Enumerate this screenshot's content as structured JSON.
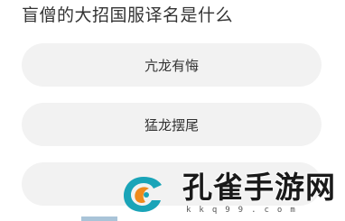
{
  "question": "盲僧的大招国服译名是什么",
  "options": [
    {
      "label": "亢龙有悔"
    },
    {
      "label": "猛龙摆尾"
    },
    {
      "label": ""
    }
  ],
  "watermark": {
    "title": "孔雀手游网",
    "subtitle": "kkq99.com"
  },
  "colors": {
    "option_bg": "#f2f2f2",
    "text": "#333333",
    "logo_teal": "#1aa4b8",
    "logo_orange": "#f08a1c"
  }
}
